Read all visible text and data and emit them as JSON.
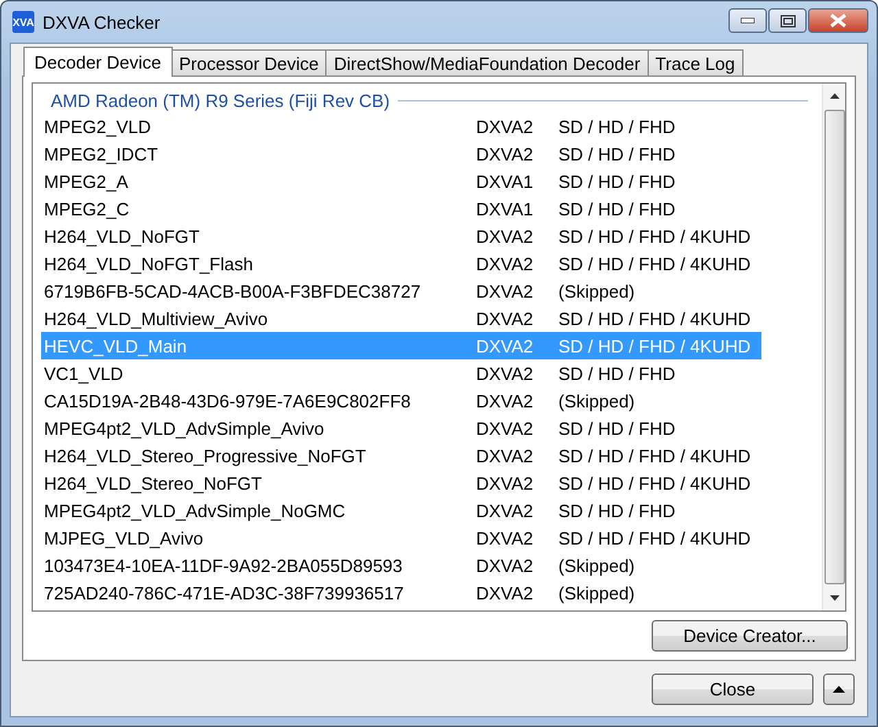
{
  "window": {
    "title": "DXVA Checker",
    "app_badge": "XVA"
  },
  "tabs": [
    {
      "label": "Decoder Device",
      "selected": true
    },
    {
      "label": "Processor Device",
      "selected": false
    },
    {
      "label": "DirectShow/MediaFoundation Decoder",
      "selected": false
    },
    {
      "label": "Trace Log",
      "selected": false
    }
  ],
  "device_group": "AMD Radeon (TM) R9 Series (Fiji Rev CB)",
  "rows": [
    {
      "name": "MPEG2_VLD",
      "api": "DXVA2",
      "resolutions": "SD / HD / FHD",
      "selected": false
    },
    {
      "name": "MPEG2_IDCT",
      "api": "DXVA2",
      "resolutions": "SD / HD / FHD",
      "selected": false
    },
    {
      "name": "MPEG2_A",
      "api": "DXVA1",
      "resolutions": "SD / HD / FHD",
      "selected": false
    },
    {
      "name": "MPEG2_C",
      "api": "DXVA1",
      "resolutions": "SD / HD / FHD",
      "selected": false
    },
    {
      "name": "H264_VLD_NoFGT",
      "api": "DXVA2",
      "resolutions": "SD / HD / FHD / 4KUHD",
      "selected": false
    },
    {
      "name": "H264_VLD_NoFGT_Flash",
      "api": "DXVA2",
      "resolutions": "SD / HD / FHD / 4KUHD",
      "selected": false
    },
    {
      "name": "6719B6FB-5CAD-4ACB-B00A-F3BFDEC38727",
      "api": "DXVA2",
      "resolutions": "(Skipped)",
      "selected": false
    },
    {
      "name": "H264_VLD_Multiview_Avivo",
      "api": "DXVA2",
      "resolutions": "SD / HD / FHD / 4KUHD",
      "selected": false
    },
    {
      "name": "HEVC_VLD_Main",
      "api": "DXVA2",
      "resolutions": "SD / HD / FHD / 4KUHD",
      "selected": true
    },
    {
      "name": "VC1_VLD",
      "api": "DXVA2",
      "resolutions": "SD / HD / FHD",
      "selected": false
    },
    {
      "name": "CA15D19A-2B48-43D6-979E-7A6E9C802FF8",
      "api": "DXVA2",
      "resolutions": "(Skipped)",
      "selected": false
    },
    {
      "name": "MPEG4pt2_VLD_AdvSimple_Avivo",
      "api": "DXVA2",
      "resolutions": "SD / HD / FHD",
      "selected": false
    },
    {
      "name": "H264_VLD_Stereo_Progressive_NoFGT",
      "api": "DXVA2",
      "resolutions": "SD / HD / FHD / 4KUHD",
      "selected": false
    },
    {
      "name": "H264_VLD_Stereo_NoFGT",
      "api": "DXVA2",
      "resolutions": "SD / HD / FHD / 4KUHD",
      "selected": false
    },
    {
      "name": "MPEG4pt2_VLD_AdvSimple_NoGMC",
      "api": "DXVA2",
      "resolutions": "SD / HD / FHD",
      "selected": false
    },
    {
      "name": "MJPEG_VLD_Avivo",
      "api": "DXVA2",
      "resolutions": "SD / HD / FHD / 4KUHD",
      "selected": false
    },
    {
      "name": "103473E4-10EA-11DF-9A92-2BA055D89593",
      "api": "DXVA2",
      "resolutions": "(Skipped)",
      "selected": false
    },
    {
      "name": "725AD240-786C-471E-AD3C-38F739936517",
      "api": "DXVA2",
      "resolutions": "(Skipped)",
      "selected": false
    }
  ],
  "buttons": {
    "device_creator": "Device Creator...",
    "close": "Close"
  }
}
